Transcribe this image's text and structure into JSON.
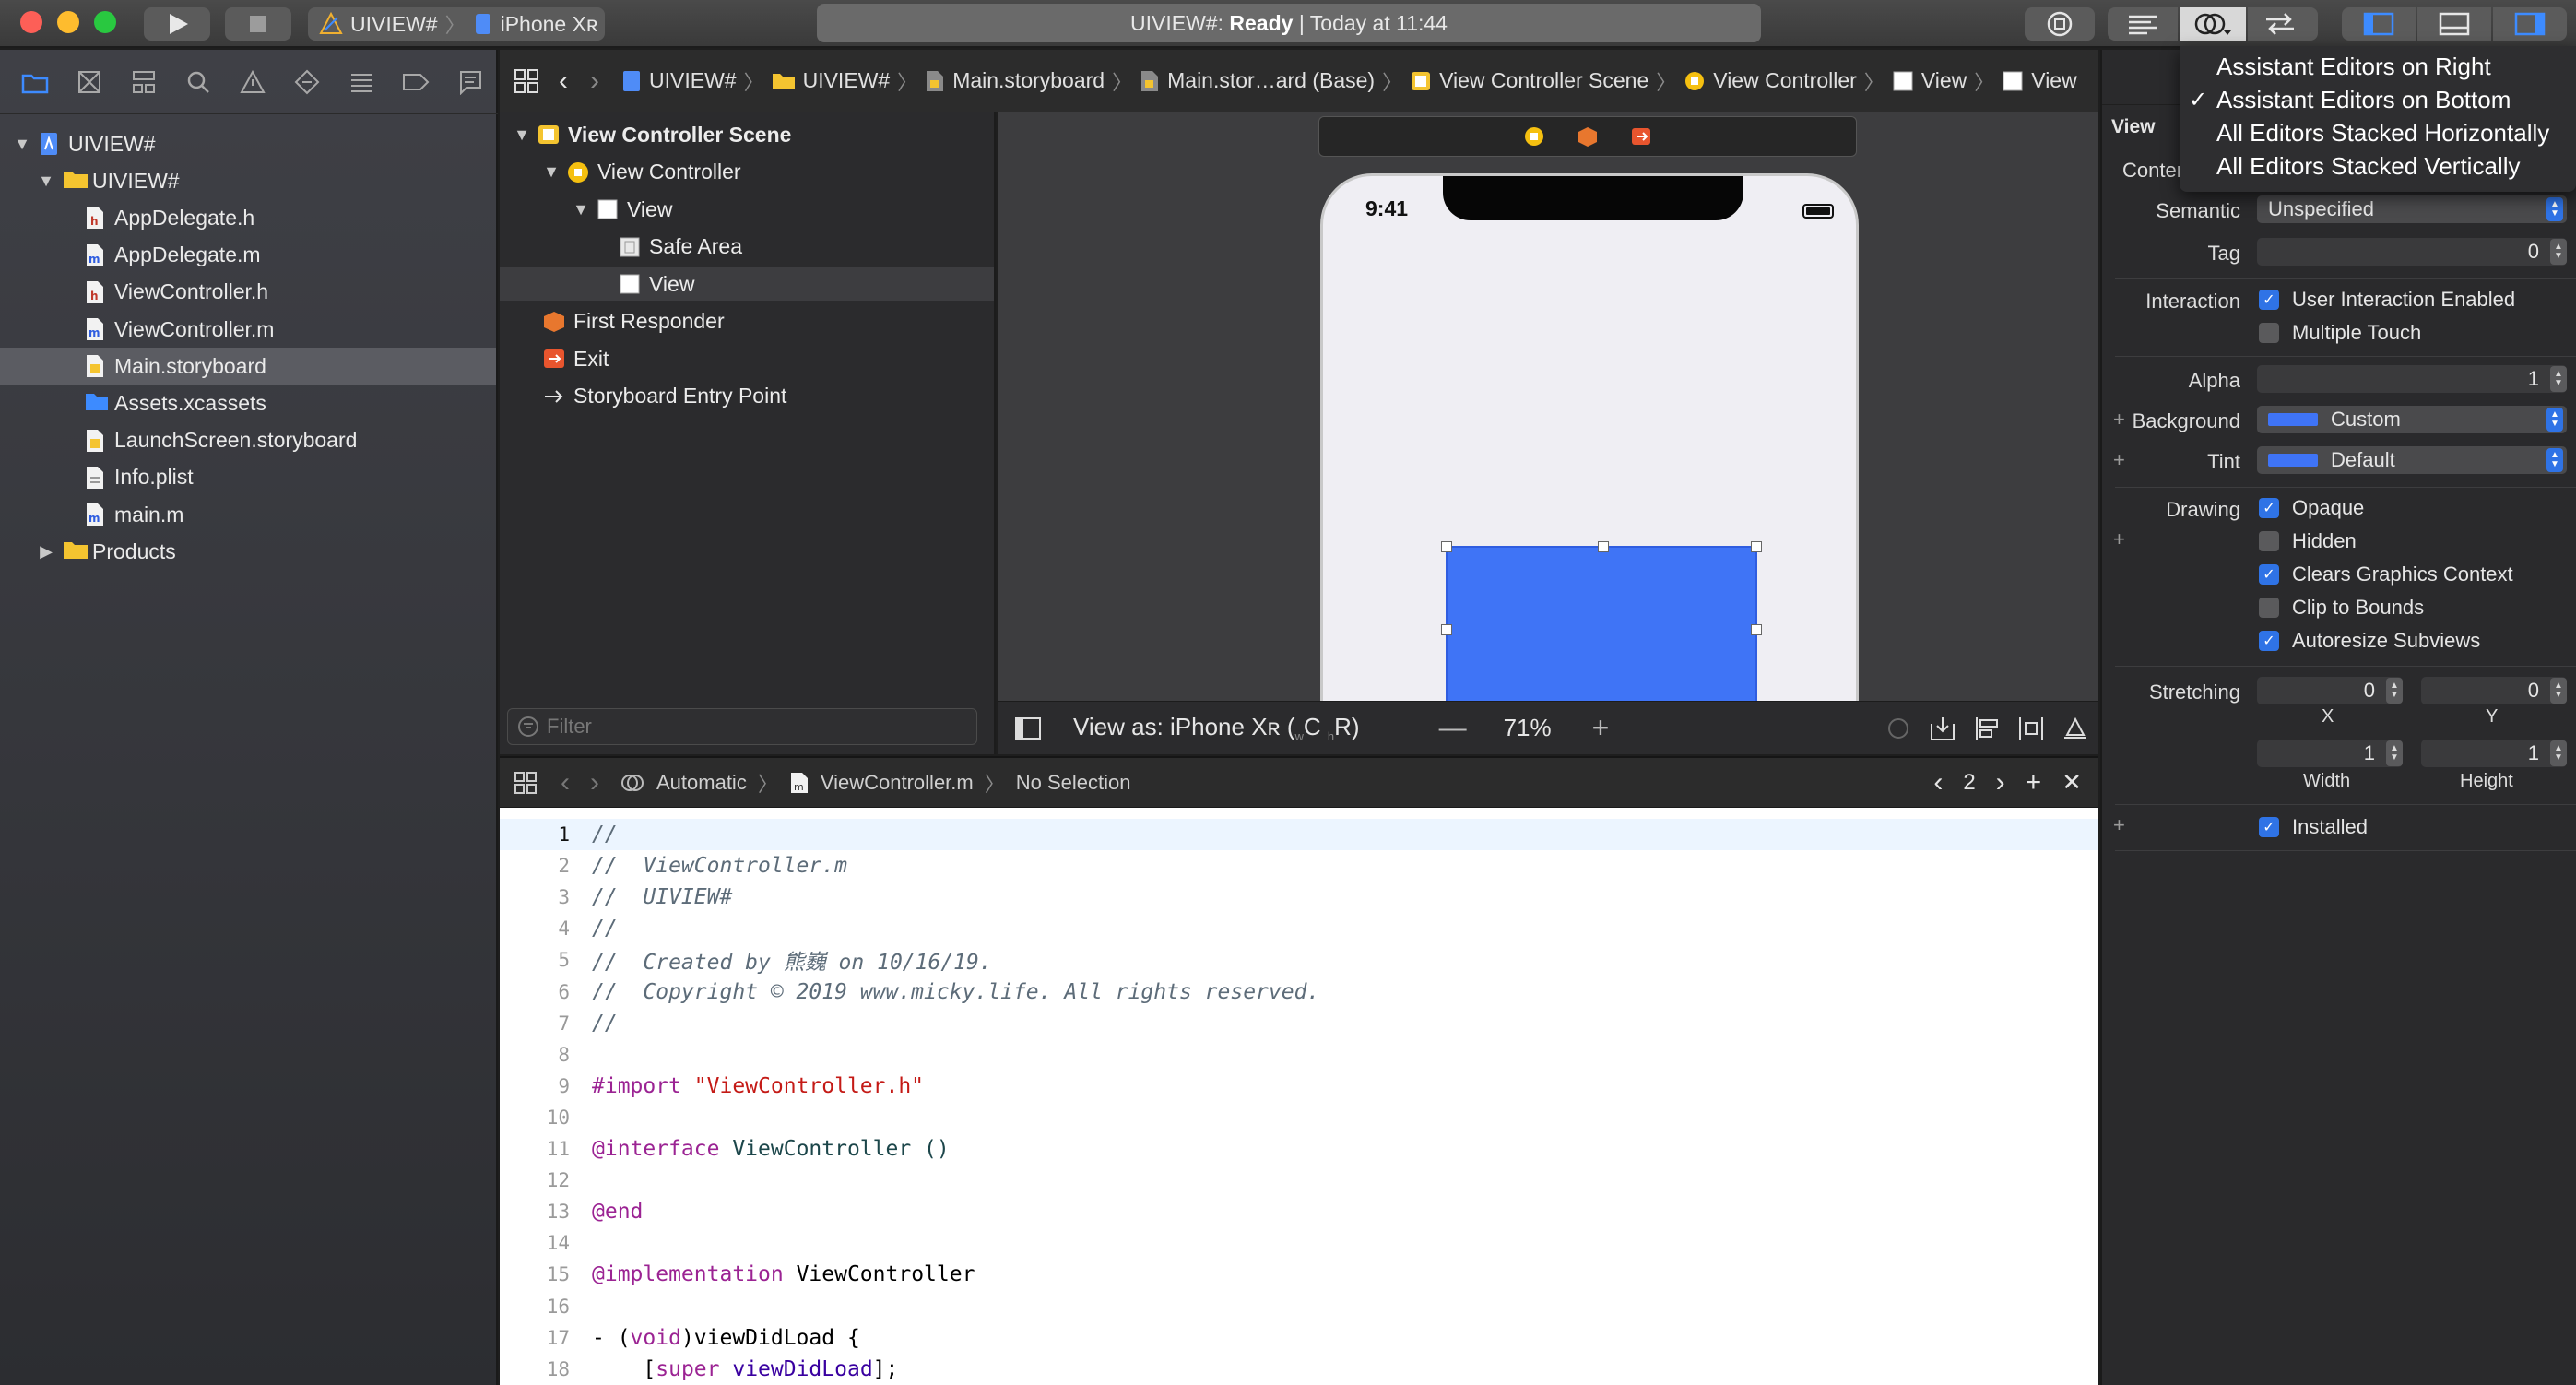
{
  "toolbar": {
    "scheme_name": "UIVIEW#",
    "device_name": "iPhone Xʀ",
    "activity_project": "UIVIEW#:",
    "activity_status": "Ready",
    "activity_time": "| Today at 11:44"
  },
  "navigator": {
    "items": [
      {
        "label": "UIVIEW#",
        "kind": "project",
        "level": 0,
        "disclosure": "open"
      },
      {
        "label": "UIVIEW#",
        "kind": "folder",
        "level": 1,
        "disclosure": "open"
      },
      {
        "label": "AppDelegate.h",
        "kind": "h-file",
        "level": 2
      },
      {
        "label": "AppDelegate.m",
        "kind": "m-file",
        "level": 2
      },
      {
        "label": "ViewController.h",
        "kind": "h-file",
        "level": 2
      },
      {
        "label": "ViewController.m",
        "kind": "m-file",
        "level": 2
      },
      {
        "label": "Main.storyboard",
        "kind": "storyboard",
        "level": 2,
        "selected": true
      },
      {
        "label": "Assets.xcassets",
        "kind": "assets",
        "level": 2
      },
      {
        "label": "LaunchScreen.storyboard",
        "kind": "storyboard",
        "level": 2
      },
      {
        "label": "Info.plist",
        "kind": "plist",
        "level": 2
      },
      {
        "label": "main.m",
        "kind": "m-file",
        "level": 2
      },
      {
        "label": "Products",
        "kind": "folder",
        "level": 1,
        "disclosure": "closed"
      }
    ]
  },
  "jumpbar": {
    "crumbs": [
      "UIVIEW#",
      "UIVIEW#",
      "Main.storyboard",
      "Main.stor…ard (Base)",
      "View Controller Scene",
      "View Controller",
      "View",
      "View"
    ]
  },
  "outline": {
    "rows": [
      {
        "label": "View Controller Scene",
        "level": 0,
        "bold": true
      },
      {
        "label": "View Controller",
        "level": 1
      },
      {
        "label": "View",
        "level": 2
      },
      {
        "label": "Safe Area",
        "level": 3
      },
      {
        "label": "View",
        "level": 3,
        "selected": true
      },
      {
        "label": "First Responder",
        "level": 1
      },
      {
        "label": "Exit",
        "level": 1
      },
      {
        "label": "Storyboard Entry Point",
        "level": 1
      }
    ],
    "filter_placeholder": "Filter"
  },
  "canvas": {
    "phone_time": "9:41",
    "view_as_prefix": "View as: iPhone Xʀ (",
    "view_as_w": "w",
    "view_as_c": "C",
    "view_as_h": "h",
    "view_as_r": "R)",
    "zoom": "71%",
    "blue_view_color": "#3f74f6"
  },
  "assistant": {
    "mode": "Automatic",
    "file": "ViewController.m",
    "selection": "No Selection",
    "counter": "2"
  },
  "code": {
    "lines": [
      {
        "n": "1",
        "text": "//",
        "cls": "cmt"
      },
      {
        "n": "2",
        "text": "//  ViewController.m",
        "cls": "cmt"
      },
      {
        "n": "3",
        "text": "//  UIVIEW#",
        "cls": "cmt"
      },
      {
        "n": "4",
        "text": "//",
        "cls": "cmt"
      },
      {
        "n": "5",
        "text": "//  Created by 熊巍 on 10/16/19.",
        "cls": "cmt"
      },
      {
        "n": "6",
        "text": "//  Copyright © 2019 www.micky.life. All rights reserved.",
        "cls": "cmt"
      },
      {
        "n": "7",
        "text": "//",
        "cls": "cmt"
      },
      {
        "n": "8",
        "text": "",
        "cls": "pl"
      },
      {
        "n": "9",
        "text": "",
        "cls": "pl"
      },
      {
        "n": "10",
        "text": "",
        "cls": "pl"
      },
      {
        "n": "11",
        "text": "",
        "cls": "pl"
      },
      {
        "n": "12",
        "text": "",
        "cls": "pl"
      },
      {
        "n": "13",
        "text": "@end",
        "cls": "kw"
      },
      {
        "n": "14",
        "text": "",
        "cls": "pl"
      },
      {
        "n": "15",
        "text": "",
        "cls": "pl"
      },
      {
        "n": "16",
        "text": "",
        "cls": "pl"
      },
      {
        "n": "17",
        "text": "",
        "cls": "pl"
      },
      {
        "n": "18",
        "text": "",
        "cls": "pl"
      }
    ],
    "import_kw": "#import ",
    "import_str": "\"ViewController.h\"",
    "interface_kw": "@interface",
    "interface_rest": " ViewController ()",
    "impl_kw": "@implementation",
    "impl_rest": " ViewController",
    "vdl_a": "- (",
    "vdl_void": "void",
    "vdl_b": ")viewDidLoad {",
    "super_a": "    [",
    "super_kw": "super",
    "super_b": " viewDidLoad",
    "super_c": "];"
  },
  "inspector": {
    "section_title": "View",
    "content_label": "Conten",
    "semantic_label": "Semantic",
    "semantic_value": "Unspecified",
    "tag_label": "Tag",
    "tag_value": "0",
    "interaction_label": "Interaction",
    "user_interaction": "User Interaction Enabled",
    "multiple_touch": "Multiple Touch",
    "alpha_label": "Alpha",
    "alpha_value": "1",
    "background_label": "Background",
    "background_value": "Custom",
    "tint_label": "Tint",
    "tint_value": "Default",
    "drawing_label": "Drawing",
    "opaque": "Opaque",
    "hidden": "Hidden",
    "clears": "Clears Graphics Context",
    "clip": "Clip to Bounds",
    "autoresize": "Autoresize Subviews",
    "stretching_label": "Stretching",
    "stretch_x": "0",
    "stretch_y": "0",
    "x_label": "X",
    "y_label": "Y",
    "stretch_w": "1",
    "stretch_h": "1",
    "width_label": "Width",
    "height_label": "Height",
    "installed": "Installed",
    "swatch_color": "#3f74f6"
  },
  "menu": {
    "items": [
      {
        "label": "Assistant Editors on Right",
        "checked": false
      },
      {
        "label": "Assistant Editors on Bottom",
        "checked": true
      },
      {
        "label": "All Editors Stacked Horizontally",
        "checked": false
      },
      {
        "label": "All Editors Stacked Vertically",
        "checked": false
      }
    ]
  }
}
